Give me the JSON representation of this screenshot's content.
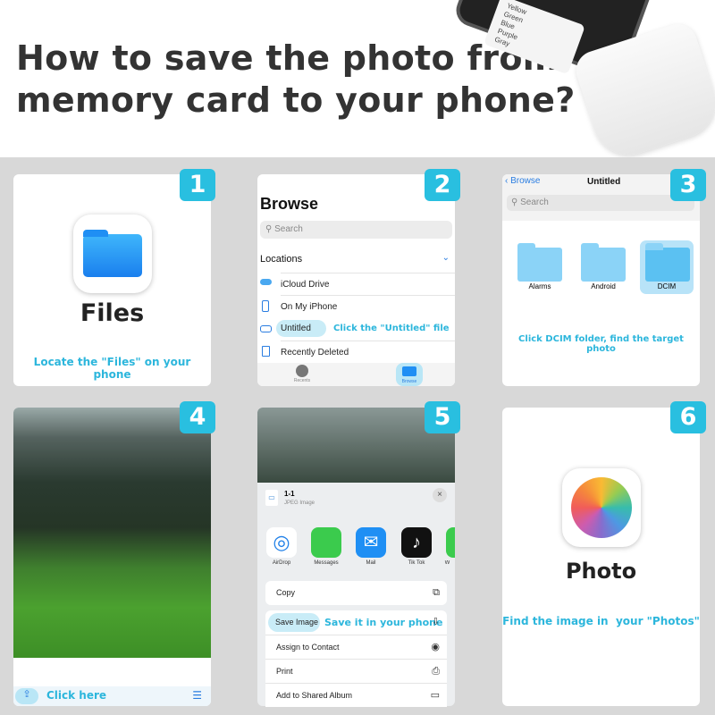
{
  "header": {
    "title_line1": "How to save the photo from",
    "title_line2": "memory card to your phone?",
    "phone_colors": [
      "Yellow",
      "Green",
      "Blue",
      "Purple",
      "Gray"
    ]
  },
  "steps": [
    {
      "number": "1",
      "app_name": "Files",
      "caption": "Locate the \"Files\" on your phone"
    },
    {
      "number": "2",
      "browse_title": "Browse",
      "search_placeholder": "Search",
      "section": "Locations",
      "items": [
        "iCloud Drive",
        "On My iPhone",
        "Untitled",
        "Recently Deleted"
      ],
      "annotation": "Click the \"Untitled\" file",
      "tabs": [
        "Recents",
        "Browse"
      ]
    },
    {
      "number": "3",
      "back_label": "Browse",
      "nav_title": "Untitled",
      "search_placeholder": "Search",
      "folders": [
        "Alarms",
        "Android",
        "DCIM"
      ],
      "caption": "Click DCIM folder, find the target photo"
    },
    {
      "number": "4",
      "caption": "Click here"
    },
    {
      "number": "5",
      "file_name": "1-1",
      "file_type": "JPEG Image",
      "apps": [
        "AirDrop",
        "Messages",
        "Mail",
        "Tik Tok",
        "W"
      ],
      "actions": [
        "Copy",
        "Save Image",
        "Assign to Contact",
        "Print",
        "Add to Shared Album"
      ],
      "annotation": "Save it in your phone"
    },
    {
      "number": "6",
      "app_name": "Photo",
      "caption": "Find the image in  your \"Photos\""
    }
  ],
  "colors": {
    "accent": "#29bfe0",
    "background": "#d8d8d8",
    "folder": "#8bd3f7"
  }
}
